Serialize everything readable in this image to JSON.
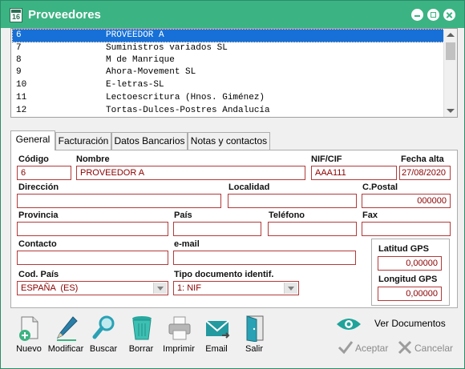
{
  "window": {
    "title": "Proveedores",
    "icon": "calendar-icon"
  },
  "list": {
    "rows": [
      {
        "code": "6",
        "name": "PROVEEDOR A",
        "selected": true
      },
      {
        "code": "7",
        "name": "Suministros variados SL"
      },
      {
        "code": "8",
        "name": "M de Manrique"
      },
      {
        "code": "9",
        "name": "Ahora-Movement SL"
      },
      {
        "code": "10",
        "name": "E-letras-SL"
      },
      {
        "code": "11",
        "name": "Lectoescritura (Hnos. Giménez)"
      },
      {
        "code": "12",
        "name": "Tortas-Dulces-Postres Andalucía"
      }
    ]
  },
  "tabs": [
    {
      "label": "General",
      "active": true
    },
    {
      "label": "Facturación"
    },
    {
      "label": "Datos Bancarios"
    },
    {
      "label": "Notas y contactos"
    }
  ],
  "form": {
    "codigo": {
      "label": "Código",
      "value": "6"
    },
    "nombre": {
      "label": "Nombre",
      "value": "PROVEEDOR A"
    },
    "nif": {
      "label": "NIF/CIF",
      "value": "AAA111"
    },
    "fecha_alta": {
      "label": "Fecha alta",
      "value": "27/08/2020"
    },
    "direccion": {
      "label": "Dirección",
      "value": ""
    },
    "localidad": {
      "label": "Localidad",
      "value": ""
    },
    "cpostal": {
      "label": "C.Postal",
      "value": "000000"
    },
    "provincia": {
      "label": "Provincia",
      "value": ""
    },
    "pais": {
      "label": "País",
      "value": ""
    },
    "telefono": {
      "label": "Teléfono",
      "value": ""
    },
    "fax": {
      "label": "Fax",
      "value": ""
    },
    "contacto": {
      "label": "Contacto",
      "value": ""
    },
    "email": {
      "label": "e-mail",
      "value": ""
    },
    "cod_pais": {
      "label": "Cod. País",
      "value": "ESPAÑA  (ES)"
    },
    "tipo_doc": {
      "label": "Tipo documento identif.",
      "value": "1: NIF"
    },
    "latitud": {
      "label": "Latitud GPS",
      "value": "0,00000"
    },
    "longitud": {
      "label": "Longitud GPS",
      "value": "0,00000"
    }
  },
  "toolbar": {
    "nuevo": {
      "label": "Nuevo",
      "icon": "new-document-icon"
    },
    "modificar": {
      "label": "Modificar",
      "icon": "pen-icon"
    },
    "buscar": {
      "label": "Buscar",
      "icon": "magnifier-icon"
    },
    "borrar": {
      "label": "Borrar",
      "icon": "trash-icon"
    },
    "imprimir": {
      "label": "Imprimir",
      "icon": "printer-icon"
    },
    "email": {
      "label": "Email",
      "icon": "envelope-icon"
    },
    "salir": {
      "label": "Salir",
      "icon": "exit-door-icon"
    }
  },
  "actions": {
    "ver_documentos": {
      "label": "Ver Documentos",
      "icon": "eye-icon"
    },
    "aceptar": {
      "label": "Aceptar",
      "icon": "check-icon"
    },
    "cancelar": {
      "label": "Cancelar",
      "icon": "x-icon"
    }
  },
  "colors": {
    "titlebar": "#3cb383",
    "selection": "#1670d7",
    "field_border": "#b33a3a",
    "field_text": "#8b0000"
  }
}
